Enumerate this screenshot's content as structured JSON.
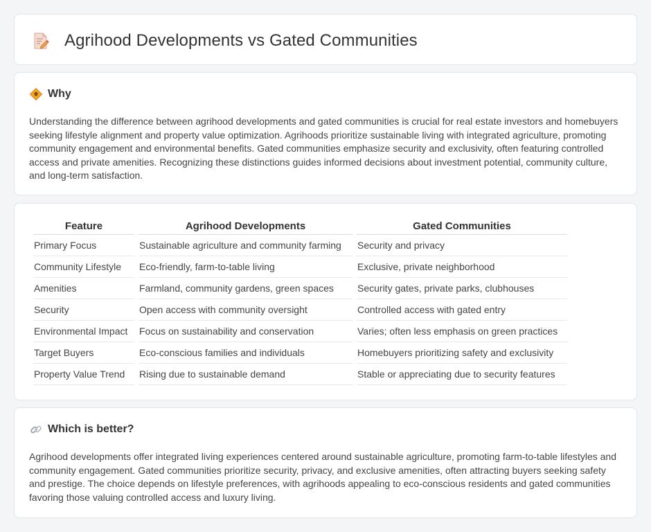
{
  "header": {
    "title": "Agrihood Developments vs Gated Communities",
    "icon": "document-pencil-icon"
  },
  "why": {
    "icon": "diamond-sign-icon",
    "title": "Why",
    "text": "Understanding the difference between agrihood developments and gated communities is crucial for real estate investors and homebuyers seeking lifestyle alignment and property value optimization. Agrihoods prioritize sustainable living with integrated agriculture, promoting community engagement and environmental benefits. Gated communities emphasize security and exclusivity, often featuring controlled access and private amenities. Recognizing these distinctions guides informed decisions about investment potential, community culture, and long-term satisfaction."
  },
  "table": {
    "headers": [
      "Feature",
      "Agrihood Developments",
      "Gated Communities"
    ],
    "rows": [
      [
        "Primary Focus",
        "Sustainable agriculture and community farming",
        "Security and privacy"
      ],
      [
        "Community Lifestyle",
        "Eco-friendly, farm-to-table living",
        "Exclusive, private neighborhood"
      ],
      [
        "Amenities",
        "Farmland, community gardens, green spaces",
        "Security gates, private parks, clubhouses"
      ],
      [
        "Security",
        "Open access with community oversight",
        "Controlled access with gated entry"
      ],
      [
        "Environmental Impact",
        "Focus on sustainability and conservation",
        "Varies; often less emphasis on green practices"
      ],
      [
        "Target Buyers",
        "Eco-conscious families and individuals",
        "Homebuyers prioritizing safety and exclusivity"
      ],
      [
        "Property Value Trend",
        "Rising due to sustainable demand",
        "Stable or appreciating due to security features"
      ]
    ]
  },
  "better": {
    "icon": "link-icon",
    "title": "Which is better?",
    "text": "Agrihood developments offer integrated living experiences centered around sustainable agriculture, promoting farm-to-table lifestyles and community engagement. Gated communities prioritize security, privacy, and exclusive amenities, often attracting buyers seeking safety and prestige. The choice depends on lifestyle preferences, with agrihoods appealing to eco-conscious residents and gated communities favoring those valuing controlled access and luxury living."
  }
}
